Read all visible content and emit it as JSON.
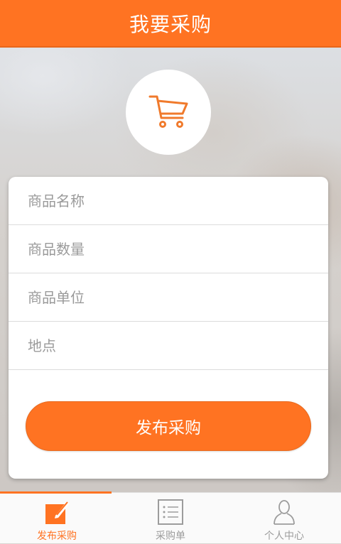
{
  "header": {
    "title": "我要采购"
  },
  "form": {
    "fields": [
      {
        "placeholder": "商品名称",
        "value": ""
      },
      {
        "placeholder": "商品数量",
        "value": ""
      },
      {
        "placeholder": "商品单位",
        "value": ""
      },
      {
        "placeholder": "地点",
        "value": ""
      }
    ],
    "submit_label": "发布采购"
  },
  "tabbar": {
    "items": [
      {
        "label": "发布采购",
        "icon": "edit-icon",
        "active": true
      },
      {
        "label": "采购单",
        "icon": "list-icon",
        "active": false
      },
      {
        "label": "个人中心",
        "icon": "user-icon",
        "active": false
      }
    ]
  },
  "colors": {
    "accent": "#ff7322",
    "inactive": "#9c9c9c"
  }
}
